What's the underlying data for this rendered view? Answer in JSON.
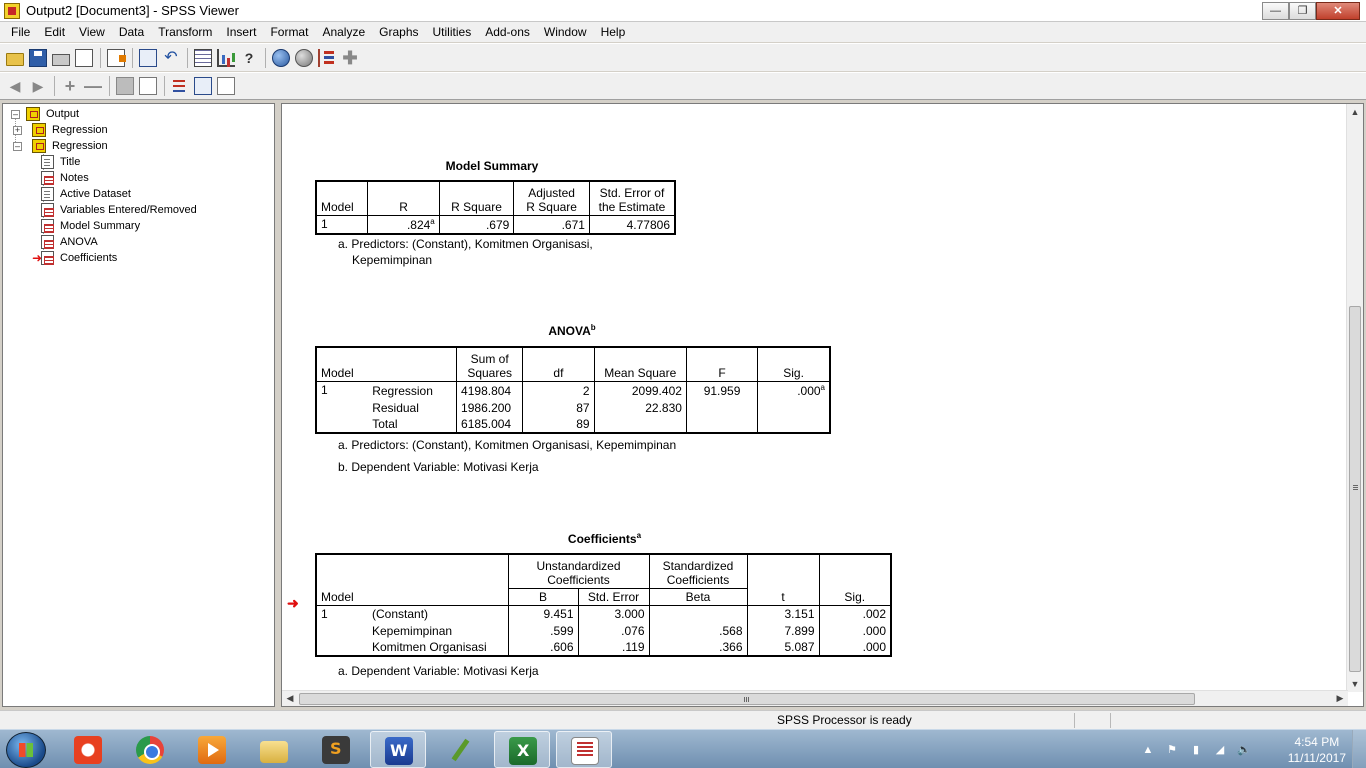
{
  "window": {
    "title": "Output2 [Document3] - SPSS Viewer"
  },
  "menu": [
    "File",
    "Edit",
    "View",
    "Data",
    "Transform",
    "Insert",
    "Format",
    "Analyze",
    "Graphs",
    "Utilities",
    "Add-ons",
    "Window",
    "Help"
  ],
  "outline": {
    "items": [
      {
        "label": "Output",
        "icon": "book-icon"
      },
      {
        "label": "Regression",
        "icon": "book-icon"
      },
      {
        "label": "Regression",
        "icon": "book-icon"
      },
      {
        "label": "Title",
        "icon": "doc-icon"
      },
      {
        "label": "Notes",
        "icon": "table-icon"
      },
      {
        "label": "Active Dataset",
        "icon": "doc-icon"
      },
      {
        "label": "Variables Entered/Removed",
        "icon": "table-icon"
      },
      {
        "label": "Model Summary",
        "icon": "table-icon"
      },
      {
        "label": "ANOVA",
        "icon": "table-icon"
      },
      {
        "label": "Coefficients",
        "icon": "table-icon"
      }
    ]
  },
  "model_summary": {
    "title": "Model Summary",
    "headers": {
      "model": "Model",
      "r": "R",
      "r_square": "R Square",
      "adj_r_square_1": "Adjusted",
      "adj_r_square_2": "R Square",
      "std_err_1": "Std. Error of",
      "std_err_2": "the Estimate"
    },
    "row": {
      "model": "1",
      "r": ".824",
      "r_sup": "a",
      "r_square": ".679",
      "adj_r_square": ".671",
      "std_err": "4.77806"
    },
    "footnote_a": "a. Predictors: (Constant), Komitmen Organisasi,",
    "footnote_a2": "Kepemimpinan"
  },
  "anova": {
    "title": "ANOVA",
    "title_sup": "b",
    "headers": {
      "model": "Model",
      "ss_1": "Sum of",
      "ss_2": "Squares",
      "df": "df",
      "ms": "Mean Square",
      "f": "F",
      "sig": "Sig."
    },
    "rows": [
      {
        "model": "1",
        "label": "Regression",
        "ss": "4198.804",
        "df": "2",
        "ms": "2099.402",
        "f": "91.959",
        "sig": ".000",
        "sig_sup": "a"
      },
      {
        "model": "",
        "label": "Residual",
        "ss": "1986.200",
        "df": "87",
        "ms": "22.830",
        "f": "",
        "sig": "",
        "sig_sup": ""
      },
      {
        "model": "",
        "label": "Total",
        "ss": "6185.004",
        "df": "89",
        "ms": "",
        "f": "",
        "sig": "",
        "sig_sup": ""
      }
    ],
    "footnote_a": "a. Predictors: (Constant), Komitmen Organisasi, Kepemimpinan",
    "footnote_b": "b. Dependent Variable: Motivasi Kerja"
  },
  "coefficients": {
    "title": "Coefficients",
    "title_sup": "a",
    "headers": {
      "unstd_1": "Unstandardized",
      "unstd_2": "Coefficients",
      "std_1": "Standardized",
      "std_2": "Coefficients",
      "model": "Model",
      "b": "B",
      "se": "Std. Error",
      "beta": "Beta",
      "t": "t",
      "sig": "Sig."
    },
    "rows": [
      {
        "model": "1",
        "label": "(Constant)",
        "b": "9.451",
        "se": "3.000",
        "beta": "",
        "t": "3.151",
        "sig": ".002"
      },
      {
        "model": "",
        "label": "Kepemimpinan",
        "b": ".599",
        "se": ".076",
        "beta": ".568",
        "t": "7.899",
        "sig": ".000"
      },
      {
        "model": "",
        "label": "Komitmen Organisasi",
        "b": ".606",
        "se": ".119",
        "beta": ".366",
        "t": "5.087",
        "sig": ".000"
      }
    ],
    "footnote_a": "a. Dependent Variable: Motivasi Kerja"
  },
  "status": {
    "text": "SPSS Processor  is ready"
  },
  "taskbar": {
    "time": "4:54 PM",
    "date": "11/11/2017"
  }
}
